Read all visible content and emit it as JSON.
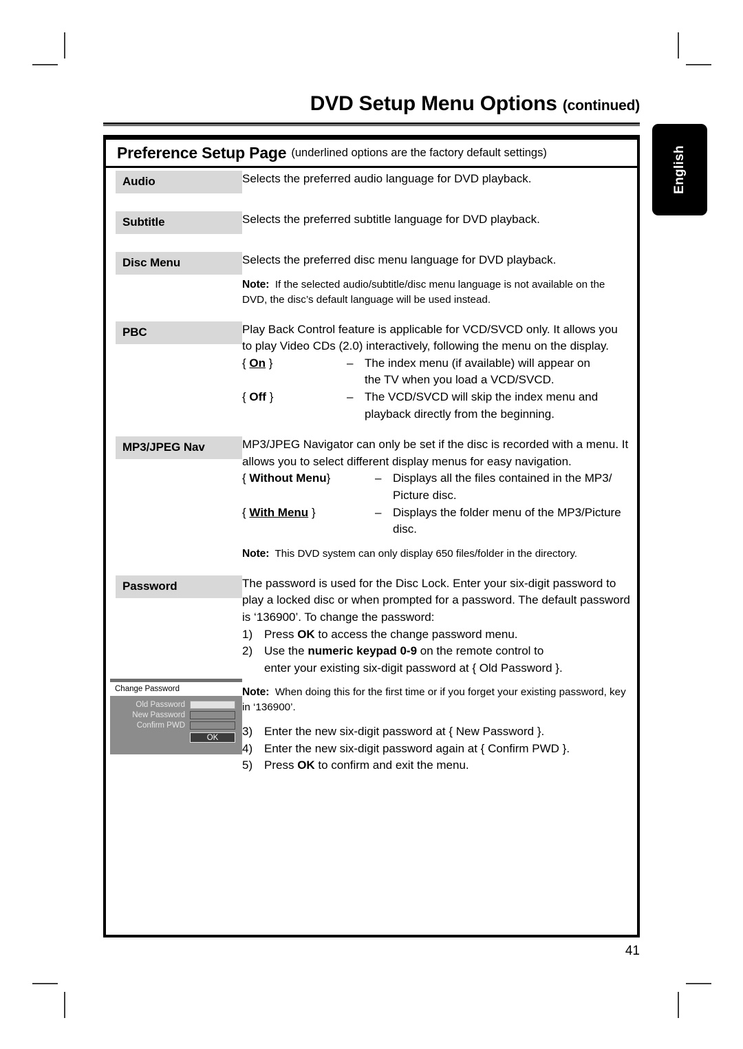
{
  "page": {
    "title_main": "DVD Setup Menu Options",
    "title_continued": "(continued)",
    "language_tab": "English",
    "page_number": "41"
  },
  "section": {
    "heading": "Preference Setup Page",
    "heading_note": "(underlined options are the factory default settings)"
  },
  "rows": {
    "audio": {
      "label": "Audio",
      "text": "Selects the preferred audio language for DVD playback."
    },
    "subtitle": {
      "label": "Subtitle",
      "text": "Selects the preferred subtitle language for DVD playback."
    },
    "disc_menu": {
      "label": "Disc Menu",
      "text": "Selects the preferred disc menu language for DVD playback.",
      "note_label": "Note:",
      "note_text": "If the selected audio/subtitle/disc menu language is not available on the DVD, the disc’s default language will be used instead."
    },
    "pbc": {
      "label": "PBC",
      "text": "Play Back Control feature is applicable for VCD/SVCD only.  It allows you to play Video CDs (2.0) interactively, following the menu on the display.",
      "options": [
        {
          "open": "{",
          "name": "On",
          "close": "}",
          "default": true,
          "dash": "–",
          "desc_line1": "The index menu (if available) will appear on",
          "desc_line2": "the TV when you load a VCD/SVCD."
        },
        {
          "open": "{",
          "name": "Off",
          "close": "}",
          "default": false,
          "dash": "–",
          "desc_line1": "The VCD/SVCD will skip the index menu and",
          "desc_line2": "playback directly from the beginning."
        }
      ]
    },
    "mp3_jpeg_nav": {
      "label": "MP3/JPEG Nav",
      "text": "MP3/JPEG Navigator can only be set if the disc is recorded with a menu.  It allows you to select different display menus for easy navigation.",
      "options": [
        {
          "open": "{",
          "name": "Without Menu",
          "close": "}",
          "default": false,
          "dash": "–",
          "desc_line1": "Displays all the files contained in the MP3/",
          "desc_line2": "Picture disc."
        },
        {
          "open": "{",
          "name": "With Menu",
          "close": "}",
          "default": true,
          "dash": "–",
          "desc_line1": "Displays the folder menu of the MP3/Picture",
          "desc_line2": "disc."
        }
      ],
      "note_label": "Note:",
      "note_text": "This DVD system can only display 650 files/folder in the directory."
    },
    "password": {
      "label": "Password",
      "text": "The password is used for the Disc Lock.  Enter your six-digit password to play a locked disc or when prompted for a password.  The default password is ‘136900’.  To change the password:",
      "steps": [
        {
          "num": "1)",
          "pre": "Press ",
          "bold": "OK",
          "post": " to access the change password menu.",
          "line2": ""
        },
        {
          "num": "2)",
          "pre": "Use the ",
          "bold": "numeric keypad 0-9",
          "post": " on the remote control to",
          "line2": "enter your existing six-digit password at { Old Password }."
        },
        {
          "num": "3)",
          "pre": "Enter the new six-digit password at { New Password }.",
          "bold": "",
          "post": "",
          "line2": ""
        },
        {
          "num": "4)",
          "pre": "Enter the new six-digit password again at { Confirm PWD }.",
          "bold": "",
          "post": "",
          "line2": ""
        },
        {
          "num": "5)",
          "pre": "Press ",
          "bold": "OK",
          "post": " to confirm and exit the menu.",
          "line2": ""
        }
      ],
      "note_label": "Note:",
      "note_text": "When doing this for the first time or if you forget your existing password, key in ‘136900’."
    }
  },
  "change_password_dialog": {
    "title": "Change Password",
    "fields": [
      {
        "label": "Old Password",
        "active": true
      },
      {
        "label": "New Password",
        "active": false
      },
      {
        "label": "Confirm PWD",
        "active": false
      }
    ],
    "ok_label": "OK"
  },
  "colors": {
    "label_chip_bg": "#d8d8d8",
    "dialog_bg": "#8c8c8c",
    "dialog_title_bg": "#ffffff",
    "dialog_ok_bg": "#3c3c3c",
    "tab_bg": "#000000",
    "text": "#000000"
  }
}
